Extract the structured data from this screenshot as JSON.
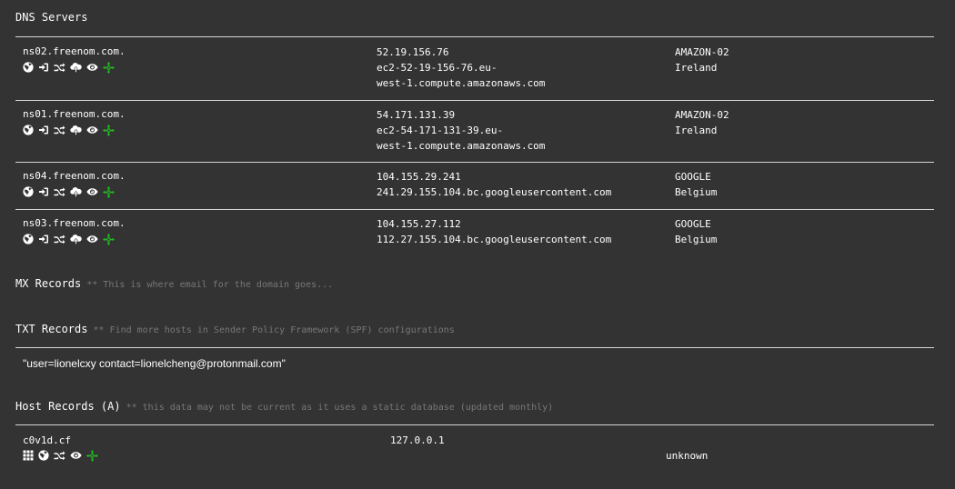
{
  "dns_section": {
    "title": "DNS Servers",
    "rows": [
      {
        "host": "ns02.freenom.com.",
        "ip": "52.19.156.76",
        "rdns": [
          "ec2-52-19-156-76.eu-",
          "west-1.compute.amazonaws.com"
        ],
        "asn": "AMAZON-02",
        "country": "Ireland"
      },
      {
        "host": "ns01.freenom.com.",
        "ip": "54.171.131.39",
        "rdns": [
          "ec2-54-171-131-39.eu-",
          "west-1.compute.amazonaws.com"
        ],
        "asn": "AMAZON-02",
        "country": "Ireland"
      },
      {
        "host": "ns04.freenom.com.",
        "ip": "104.155.29.241",
        "rdns": [
          "241.29.155.104.bc.googleusercontent.com"
        ],
        "asn": "GOOGLE",
        "country": "Belgium"
      },
      {
        "host": "ns03.freenom.com.",
        "ip": "104.155.27.112",
        "rdns": [
          "112.27.155.104.bc.googleusercontent.com"
        ],
        "asn": "GOOGLE",
        "country": "Belgium"
      }
    ],
    "row_icons": [
      "globe-icon",
      "sign-in-icon",
      "random-icon",
      "cloud-upload-icon",
      "eye-icon",
      "crosshair-icon"
    ]
  },
  "mx_section": {
    "title": "MX Records",
    "note": "** This is where email for the domain goes..."
  },
  "txt_section": {
    "title": "TXT Records",
    "note": "** Find more hosts in Sender Policy Framework (SPF) configurations",
    "records": [
      "\"user=lionelcxy contact=lionelcheng@protonmail.com\""
    ]
  },
  "host_section": {
    "title": "Host Records (A)",
    "note": "** this data may not be current as it uses a static database (updated monthly)",
    "rows": [
      {
        "host": "c0v1d.cf",
        "ip": "127.0.0.1",
        "info": "unknown"
      }
    ],
    "row_icons": [
      "grid-icon",
      "globe-icon",
      "random-icon",
      "eye-icon",
      "crosshair-icon"
    ]
  },
  "colors": {
    "background": "#333333",
    "text": "#ffffff",
    "note": "#777777",
    "rule": "#d6d6d6",
    "crosshair": "#22bb22"
  }
}
